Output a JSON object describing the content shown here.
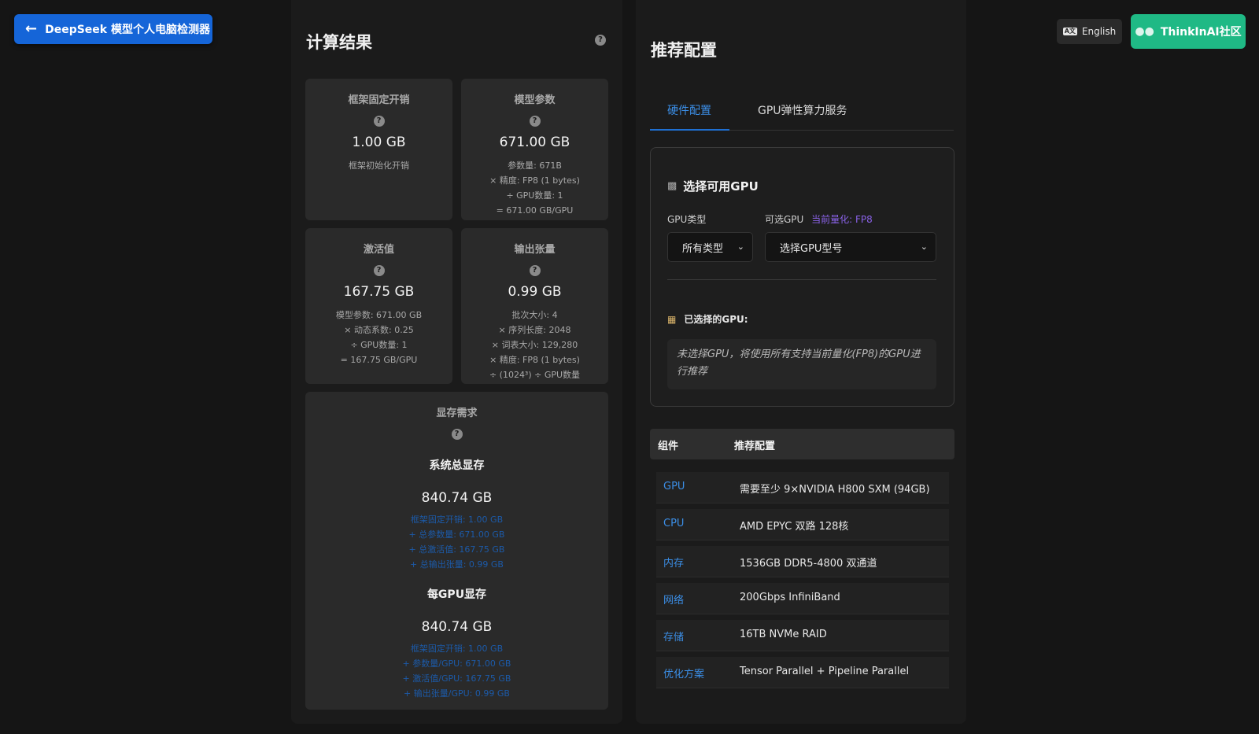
{
  "header": {
    "back_label": "DeepSeek 模型个人电脑检测器",
    "lang_label": "English",
    "community_label": "ThinkInAI社区"
  },
  "calc": {
    "title": "计算结果",
    "cards": {
      "framework": {
        "title": "框架固定开销",
        "value": "1.00 GB",
        "lines": [
          "框架初始化开销"
        ]
      },
      "params": {
        "title": "模型参数",
        "value": "671.00 GB",
        "lines": [
          "参数量: 671B",
          "× 精度: FP8 (1 bytes)",
          "÷ GPU数量: 1",
          "= 671.00 GB/GPU"
        ]
      },
      "activation": {
        "title": "激活值",
        "value": "167.75 GB",
        "lines": [
          "模型参数: 671.00 GB",
          "× 动态系数: 0.25",
          "÷ GPU数量: 1",
          "= 167.75 GB/GPU"
        ]
      },
      "output": {
        "title": "输出张量",
        "value": "0.99 GB",
        "lines": [
          "批次大小: 4",
          "× 序列长度: 2048",
          "× 词表大小: 129,280",
          "× 精度: FP8 (1 bytes)",
          "÷ (1024³) ÷ GPU数量"
        ]
      }
    },
    "memory": {
      "title": "显存需求",
      "total_label": "系统总显存",
      "total_value": "840.74 GB",
      "total_lines": [
        "框架固定开销: 1.00 GB",
        "+ 总参数量: 671.00 GB",
        "+ 总激活值: 167.75 GB",
        "+ 总输出张量: 0.99 GB"
      ],
      "per_gpu_label": "每GPU显存",
      "per_gpu_value": "840.74 GB",
      "per_gpu_lines": [
        "框架固定开销: 1.00 GB",
        "+ 参数量/GPU: 671.00 GB",
        "+ 激活值/GPU: 167.75 GB",
        "+ 输出张量/GPU: 0.99 GB"
      ]
    }
  },
  "recommend": {
    "title": "推荐配置",
    "tabs": [
      "硬件配置",
      "GPU弹性算力服务"
    ],
    "gpu_select": {
      "heading": "选择可用GPU",
      "type_label": "GPU类型",
      "gpu_label": "可选GPU",
      "quant_label": "当前量化: FP8",
      "type_value": "所有类型",
      "gpu_value": "选择GPU型号",
      "selected_label": "已选择的GPU:",
      "hint": "未选择GPU，将使用所有支持当前量化(FP8)的GPU进行推荐"
    },
    "table": {
      "headers": [
        "组件",
        "推荐配置"
      ],
      "rows": [
        {
          "name": "GPU",
          "value": "需要至少 9×NVIDIA H800 SXM (94GB)"
        },
        {
          "name": "CPU",
          "value": "AMD EPYC 双路 128核"
        },
        {
          "name": "内存",
          "value": "1536GB DDR5-4800 双通道"
        },
        {
          "name": "网络",
          "value": "200Gbps InfiniBand"
        },
        {
          "name": "存储",
          "value": "16TB NVMe RAID"
        },
        {
          "name": "优化方案",
          "value": "Tensor Parallel + Pipeline Parallel"
        }
      ]
    }
  }
}
